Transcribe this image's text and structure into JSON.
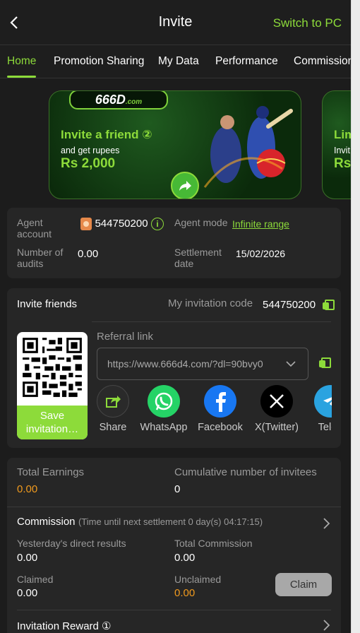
{
  "header": {
    "title": "Invite",
    "switch_label": "Switch to PC"
  },
  "tabs": [
    {
      "label": "Home",
      "active": true
    },
    {
      "label": "Promotion Sharing"
    },
    {
      "label": "My Data"
    },
    {
      "label": "Performance"
    },
    {
      "label": "Commission"
    }
  ],
  "banners": [
    {
      "logo": "666D",
      "logo_suffix": ".com",
      "title": "Invite a friend ②",
      "subtitle": "and get rupees",
      "amount": "Rs 2,000"
    },
    {
      "title": "Lim",
      "subtitle": "Invit",
      "amount": "Rs"
    }
  ],
  "agent": {
    "account_label": "Agent account",
    "account_value": "544750200",
    "mode_label": "Agent mode",
    "mode_value": "Infinite range",
    "audits_label": "Number of audits",
    "audits_value": "0.00",
    "settlement_label": "Settlement date",
    "settlement_value": "15/02/2026"
  },
  "invite": {
    "title": "Invite friends",
    "code_label": "My invitation code",
    "code_value": "544750200",
    "save_label": "Save invitation…",
    "referral_label": "Referral link",
    "referral_value": "https://www.666d4.com/?dl=90bvy0",
    "share": [
      {
        "label": "Share",
        "color": "#2a2a2a",
        "icon": "share-icon"
      },
      {
        "label": "WhatsApp",
        "color": "#25d366",
        "icon": "whatsapp-icon"
      },
      {
        "label": "Facebook",
        "color": "#1877f2",
        "icon": "facebook-icon"
      },
      {
        "label": "X(Twitter)",
        "color": "#000000",
        "icon": "x-icon"
      },
      {
        "label": "Teleg",
        "color": "#2aa3e0",
        "icon": "telegram-icon"
      }
    ]
  },
  "earnings": {
    "total_label": "Total Earnings",
    "total_value": "0.00",
    "invitees_label": "Cumulative number of invitees",
    "invitees_value": "0",
    "commission_title": "Commission",
    "commission_note": "(Time until next settlement  0 day(s) 04:17:15)",
    "yesterday_label": "Yesterday's direct results",
    "yesterday_value": "0.00",
    "total_comm_label": "Total Commission",
    "total_comm_value": "0.00",
    "claimed_label": "Claimed",
    "claimed_value": "0.00",
    "unclaimed_label": "Unclaimed",
    "unclaimed_value": "0.00",
    "claim_btn": "Claim",
    "reward_title": "Invitation Reward ①"
  },
  "colors": {
    "accent": "#8ddb3a",
    "orange": "#f09a1e",
    "bg": "#1c1c1c",
    "card": "#262626"
  }
}
